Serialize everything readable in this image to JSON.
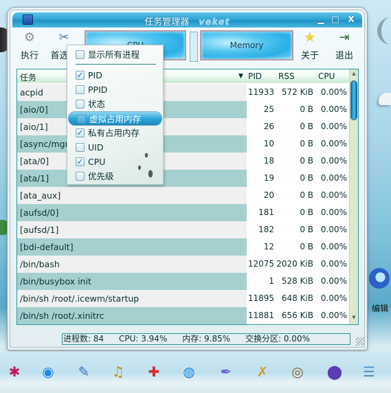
{
  "window": {
    "title": "任务管理器",
    "brand": "veket",
    "controls": {
      "minimize": "▁",
      "maximize": "□",
      "close": "X"
    }
  },
  "toolbar": {
    "execute_label": "执行",
    "preferences_label": "首选项",
    "about_label": "关于",
    "quit_label": "退出",
    "icons": {
      "execute": "⚙",
      "preferences": "✂",
      "about": "★",
      "quit": "⇥"
    }
  },
  "meters": {
    "cpu_label": "CPU",
    "memory_label": "Memory",
    "cpu_percent": 3.94,
    "memory_percent": 9.85,
    "swap_percent": 0.0
  },
  "table": {
    "columns": {
      "task": "任务",
      "sort_indicator": "▼",
      "pid": "PID",
      "rss": "RSS",
      "cpu": "CPU"
    },
    "rows": [
      {
        "task": "acpid",
        "pid": "11933",
        "rss": "572 KiB",
        "cpu": "0.00%"
      },
      {
        "task": "[aio/0]",
        "pid": "25",
        "rss": "0 B",
        "cpu": "0.00%"
      },
      {
        "task": "[aio/1]",
        "pid": "26",
        "rss": "0 B",
        "cpu": "0.00%"
      },
      {
        "task": "[async/mgr]",
        "pid": "10",
        "rss": "0 B",
        "cpu": "0.00%"
      },
      {
        "task": "[ata/0]",
        "pid": "18",
        "rss": "0 B",
        "cpu": "0.00%"
      },
      {
        "task": "[ata/1]",
        "pid": "19",
        "rss": "0 B",
        "cpu": "0.00%"
      },
      {
        "task": "[ata_aux]",
        "pid": "20",
        "rss": "0 B",
        "cpu": "0.00%"
      },
      {
        "task": "[aufsd/0]",
        "pid": "181",
        "rss": "0 B",
        "cpu": "0.00%"
      },
      {
        "task": "[aufsd/1]",
        "pid": "182",
        "rss": "0 B",
        "cpu": "0.00%"
      },
      {
        "task": "[bdi-default]",
        "pid": "12",
        "rss": "0 B",
        "cpu": "0.00%"
      },
      {
        "task": "/bin/bash",
        "pid": "12075",
        "rss": "2020 KiB",
        "cpu": "0.00%"
      },
      {
        "task": "/bin/busybox init",
        "pid": "1",
        "rss": "528 KiB",
        "cpu": "0.00%"
      },
      {
        "task": "/bin/sh /root/.icewm/startup",
        "pid": "11895",
        "rss": "648 KiB",
        "cpu": "0.00%"
      },
      {
        "task": "/bin/sh /root/.xinitrc",
        "pid": "11881",
        "rss": "656 KiB",
        "cpu": "0.00%"
      }
    ]
  },
  "status": {
    "processes": "进程数: 84",
    "cpu": "CPU: 3.94%",
    "memory": "内存: 9.85%",
    "swap": "交换分区: 0.00%"
  },
  "popup_menu": {
    "show_all": {
      "label": "显示所有进程",
      "checked": false
    },
    "items": [
      {
        "label": "PID",
        "checked": true,
        "highlighted": false
      },
      {
        "label": "PPID",
        "checked": false,
        "highlighted": false
      },
      {
        "label": "状态",
        "checked": false,
        "highlighted": false
      },
      {
        "label": "虚拟占用内存",
        "checked": false,
        "highlighted": true
      },
      {
        "label": "私有占用内存",
        "checked": true,
        "highlighted": false
      },
      {
        "label": "UID",
        "checked": false,
        "highlighted": false
      },
      {
        "label": "CPU",
        "checked": true,
        "highlighted": false
      },
      {
        "label": "优先级",
        "checked": false,
        "highlighted": false
      }
    ]
  },
  "desktop": {
    "edit_icon_label": "编辑"
  },
  "taskbar": {
    "icons": [
      {
        "name": "display-settings",
        "glyph": "✱",
        "color": "#c2185b"
      },
      {
        "name": "browser",
        "glyph": "◉",
        "color": "#1e88e5"
      },
      {
        "name": "notepad",
        "glyph": "✎",
        "color": "#3f6fb5"
      },
      {
        "name": "music-player",
        "glyph": "♫",
        "color": "#c58a1a"
      },
      {
        "name": "network",
        "glyph": "✚",
        "color": "#d32f2f"
      },
      {
        "name": "chat",
        "glyph": "◍",
        "color": "#1e88e5"
      },
      {
        "name": "document-editor",
        "glyph": "✒",
        "color": "#6a5acd"
      },
      {
        "name": "task-editor",
        "glyph": "✗",
        "color": "#d49a2a"
      },
      {
        "name": "image-viewer",
        "glyph": "◎",
        "color": "#8d5a2b"
      },
      {
        "name": "disk-manager",
        "glyph": "⬤",
        "color": "#5b3fb0"
      },
      {
        "name": "control-panel",
        "glyph": "☰",
        "color": "#4a90c2"
      }
    ]
  }
}
